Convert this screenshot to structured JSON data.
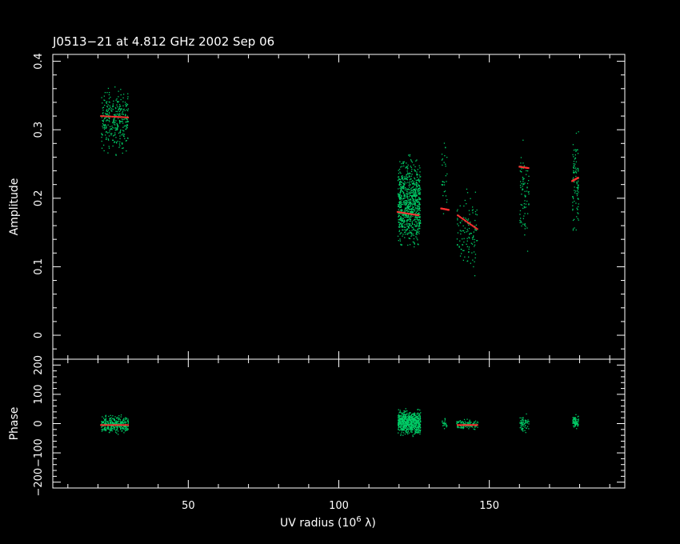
{
  "chart_data": {
    "type": "scatter",
    "title": "J0513−21 at 4.812 GHz 2002 Sep 06",
    "xlabel": "UV radius  (10",
    "xlabel_exp": "6",
    "xlabel_unit": " λ)",
    "xlim": [
      5,
      195
    ],
    "xticks": [
      50,
      100,
      150
    ],
    "colors": {
      "background": "#000000",
      "axes": "#ffffff",
      "data": "#00cc66",
      "model": "#ff3030"
    },
    "panels": [
      {
        "id": "amplitude",
        "ylabel": "Amplitude",
        "ylim": [
          -0.035,
          0.41
        ],
        "yticks": [
          0,
          0.1,
          0.2,
          0.3,
          0.4
        ],
        "ytick_labels": [
          "0",
          "0.1",
          "0.2",
          "0.3",
          "0.4"
        ],
        "data_clusters": [
          {
            "x": [
              21,
              30
            ],
            "y": [
              0.255,
              0.375
            ],
            "n": 320
          },
          {
            "x": [
              119.5,
              127
            ],
            "y": [
              0.11,
              0.275
            ],
            "n": 850
          },
          {
            "x": [
              134,
              136
            ],
            "y": [
              0.15,
              0.31
            ],
            "n": 30
          },
          {
            "x": [
              139,
              146
            ],
            "y": [
              0.07,
              0.23
            ],
            "n": 120
          },
          {
            "x": [
              160,
              163
            ],
            "y": [
              0.11,
              0.31
            ],
            "n": 80
          },
          {
            "x": [
              177.5,
              179.5
            ],
            "y": [
              0.13,
              0.315
            ],
            "n": 100
          }
        ],
        "model_segments": [
          {
            "x": [
              21,
              30
            ],
            "y": [
              0.32,
              0.318
            ]
          },
          {
            "x": [
              119.5,
              126.5
            ],
            "y": [
              0.18,
              0.175
            ]
          },
          {
            "x": [
              134,
              136.5
            ],
            "y": [
              0.185,
              0.183
            ]
          },
          {
            "x": [
              139.5,
              146
            ],
            "y": [
              0.175,
              0.155
            ]
          },
          {
            "x": [
              160,
              163
            ],
            "y": [
              0.246,
              0.244
            ]
          },
          {
            "x": [
              177.5,
              179.5
            ],
            "y": [
              0.225,
              0.23
            ]
          }
        ]
      },
      {
        "id": "phase",
        "ylabel": "Phase",
        "ylim": [
          -220,
          220
        ],
        "yticks": [
          -200,
          -100,
          0,
          100,
          200
        ],
        "ytick_labels": [
          "−200",
          "−100",
          "0",
          "100",
          "200"
        ],
        "data_clusters": [
          {
            "x": [
              21,
              30
            ],
            "y": [
              -40,
              40
            ],
            "n": 300
          },
          {
            "x": [
              119.5,
              127
            ],
            "y": [
              -50,
              60
            ],
            "n": 700
          },
          {
            "x": [
              134,
              136
            ],
            "y": [
              -20,
              30
            ],
            "n": 25
          },
          {
            "x": [
              139,
              146
            ],
            "y": [
              -25,
              20
            ],
            "n": 110
          },
          {
            "x": [
              160,
              163
            ],
            "y": [
              -40,
              40
            ],
            "n": 70
          },
          {
            "x": [
              177.5,
              179.5
            ],
            "y": [
              -25,
              40
            ],
            "n": 80
          }
        ],
        "model_segments": [
          {
            "x": [
              21,
              30
            ],
            "y": [
              -5,
              -5
            ]
          },
          {
            "x": [
              139.5,
              146
            ],
            "y": [
              -5,
              -5
            ]
          }
        ]
      }
    ]
  }
}
